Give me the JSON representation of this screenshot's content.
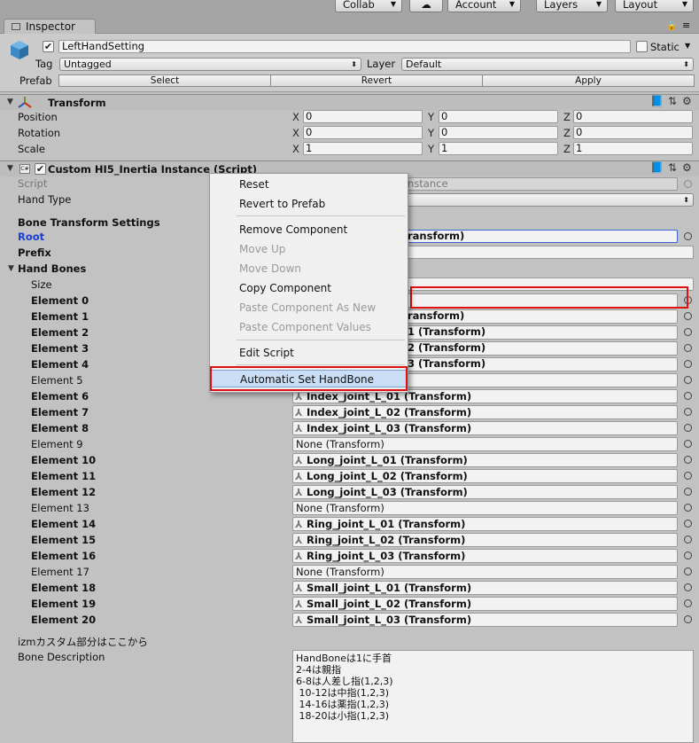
{
  "toolbar": {
    "collab": "Collab",
    "account": "Account",
    "layers": "Layers",
    "layout": "Layout"
  },
  "tab": {
    "label": "Inspector"
  },
  "header": {
    "object_name": "LeftHandSetting",
    "active_checked": true,
    "static_label": "Static",
    "tag_label": "Tag",
    "tag_value": "Untagged",
    "layer_label": "Layer",
    "layer_value": "Default",
    "prefab_label": "Prefab",
    "prefab_select": "Select",
    "prefab_revert": "Revert",
    "prefab_apply": "Apply"
  },
  "transform": {
    "title": "Transform",
    "rows": [
      {
        "label": "Position",
        "x": "0",
        "y": "0",
        "z": "0"
      },
      {
        "label": "Rotation",
        "x": "0",
        "y": "0",
        "z": "0"
      },
      {
        "label": "Scale",
        "x": "1",
        "y": "1",
        "z": "1"
      }
    ],
    "axis_x": "X",
    "axis_y": "Y",
    "axis_z": "Z"
  },
  "script_component": {
    "title": "Custom HI5_Inertia Instance (Script)",
    "script_label": "Script",
    "script_value_tail": "nstance",
    "hand_type_label": "Hand Type",
    "bone_settings_label": "Bone Transform Settings",
    "root_label": "Root",
    "root_value_tail": "ransform)",
    "prefix_label": "Prefix",
    "hand_bones_label": "Hand Bones",
    "size_label": "Size",
    "elements": [
      {
        "label": "Element 0",
        "value": ""
      },
      {
        "label": "Element 1",
        "value": "ransform)"
      },
      {
        "label": "Element 2",
        "value": "1 (Transform)"
      },
      {
        "label": "Element 3",
        "value": "2 (Transform)"
      },
      {
        "label": "Element 4",
        "value": "3 (Transform)"
      },
      {
        "label": "Element 5",
        "value": ""
      },
      {
        "label": "Element 6",
        "value": "Index_joint_L_01 (Transform)"
      },
      {
        "label": "Element 7",
        "value": "Index_joint_L_02 (Transform)"
      },
      {
        "label": "Element 8",
        "value": "Index_joint_L_03 (Transform)"
      },
      {
        "label": "Element 9",
        "value": "None (Transform)"
      },
      {
        "label": "Element 10",
        "value": "Long_joint_L_01 (Transform)"
      },
      {
        "label": "Element 11",
        "value": "Long_joint_L_02 (Transform)"
      },
      {
        "label": "Element 12",
        "value": "Long_joint_L_03 (Transform)"
      },
      {
        "label": "Element 13",
        "value": "None (Transform)"
      },
      {
        "label": "Element 14",
        "value": "Ring_joint_L_01 (Transform)"
      },
      {
        "label": "Element 15",
        "value": "Ring_joint_L_02 (Transform)"
      },
      {
        "label": "Element 16",
        "value": "Ring_joint_L_03 (Transform)"
      },
      {
        "label": "Element 17",
        "value": "None (Transform)"
      },
      {
        "label": "Element 18",
        "value": "Small_joint_L_01 (Transform)"
      },
      {
        "label": "Element 19",
        "value": "Small_joint_L_02 (Transform)"
      },
      {
        "label": "Element 20",
        "value": "Small_joint_L_03 (Transform)"
      }
    ],
    "custom_section_label": "izmカスタム部分はここから",
    "bone_description_label": "Bone Description",
    "bone_description_text": "HandBoneは1に手首\n2-4は親指\n6-8は人差し指(1,2,3)\n 10-12は中指(1,2,3)\n 14-16は薬指(1,2,3)\n 18-20は小指(1,2,3)"
  },
  "context_menu": {
    "items": [
      {
        "label": "Reset",
        "enabled": true
      },
      {
        "label": "Revert to Prefab",
        "enabled": true
      },
      {
        "label": "Remove Component",
        "enabled": true
      },
      {
        "label": "Move Up",
        "enabled": false
      },
      {
        "label": "Move Down",
        "enabled": false
      },
      {
        "label": "Copy Component",
        "enabled": true
      },
      {
        "label": "Paste Component As New",
        "enabled": false
      },
      {
        "label": "Paste Component Values",
        "enabled": false
      },
      {
        "label": "Edit Script",
        "enabled": true
      },
      {
        "label": "Automatic Set HandBone",
        "enabled": true,
        "highlighted": true
      }
    ]
  },
  "colors": {
    "highlight_red": "#e01010",
    "root_label_blue": "#1a3fd6",
    "menu_highlight": "#c9def5"
  }
}
